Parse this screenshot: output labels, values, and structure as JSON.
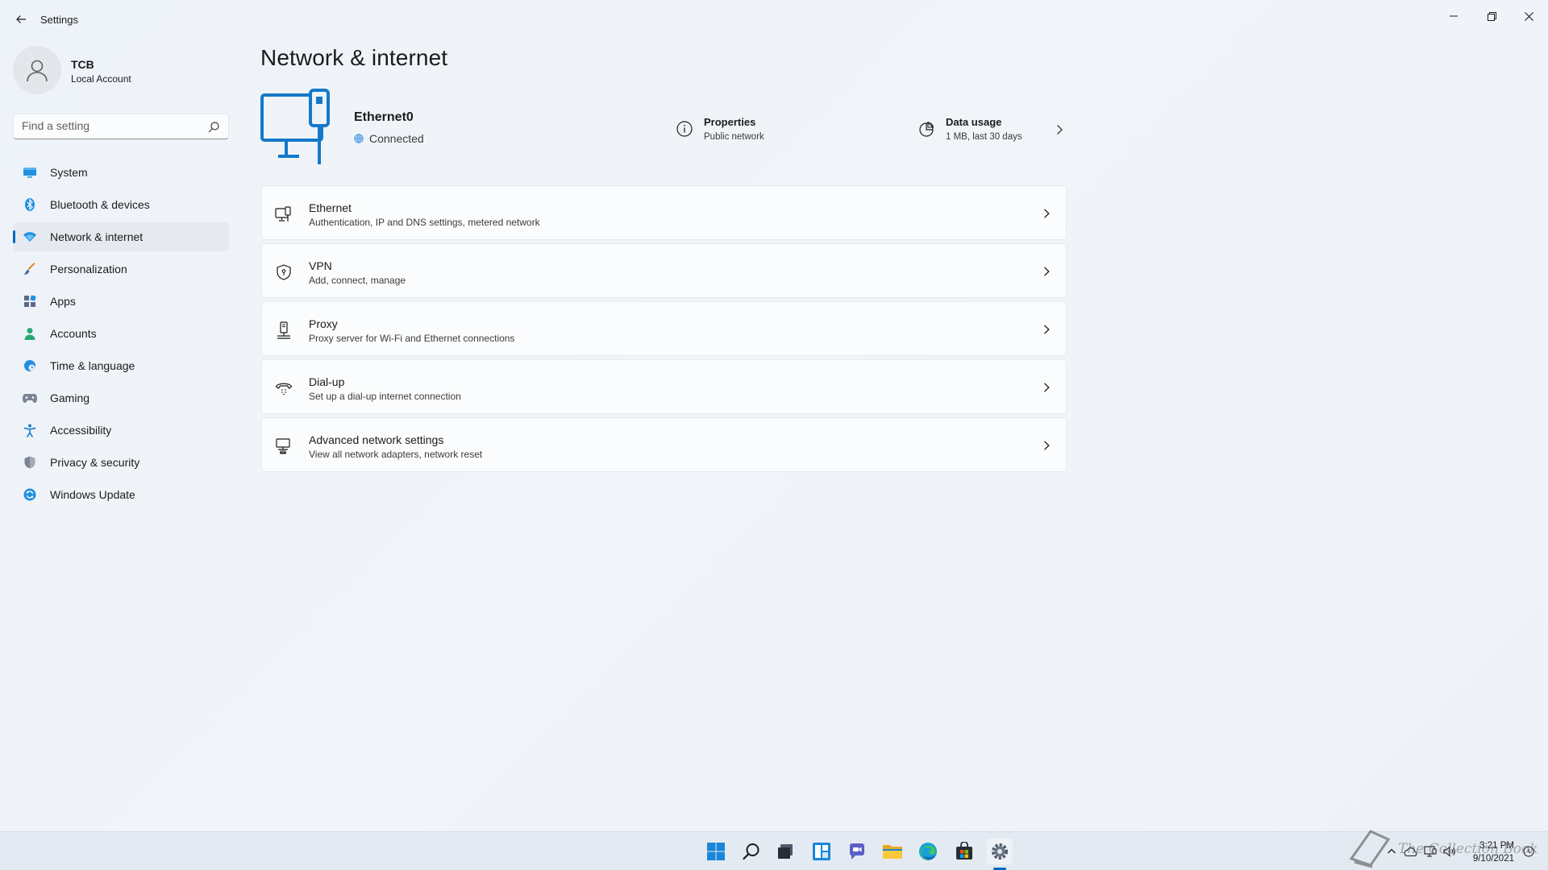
{
  "window": {
    "app_title": "Settings",
    "controls": [
      "minimize",
      "restore",
      "close"
    ]
  },
  "profile": {
    "name": "TCB",
    "account_type": "Local Account"
  },
  "search": {
    "placeholder": "Find a setting"
  },
  "sidebar": {
    "items": [
      {
        "label": "System",
        "icon": "monitor-icon",
        "active": false
      },
      {
        "label": "Bluetooth & devices",
        "icon": "bluetooth-icon",
        "active": false
      },
      {
        "label": "Network & internet",
        "icon": "wifi-icon",
        "active": true
      },
      {
        "label": "Personalization",
        "icon": "brush-icon",
        "active": false
      },
      {
        "label": "Apps",
        "icon": "apps-icon",
        "active": false
      },
      {
        "label": "Accounts",
        "icon": "person-icon",
        "active": false
      },
      {
        "label": "Time & language",
        "icon": "globe-clock-icon",
        "active": false
      },
      {
        "label": "Gaming",
        "icon": "gamepad-icon",
        "active": false
      },
      {
        "label": "Accessibility",
        "icon": "accessibility-icon",
        "active": false
      },
      {
        "label": "Privacy & security",
        "icon": "shield-icon",
        "active": false
      },
      {
        "label": "Windows Update",
        "icon": "update-icon",
        "active": false
      }
    ]
  },
  "main": {
    "title": "Network & internet",
    "connection": {
      "name": "Ethernet0",
      "status": "Connected",
      "properties_title": "Properties",
      "properties_sub": "Public network",
      "usage_title": "Data usage",
      "usage_sub": "1 MB, last 30 days"
    },
    "cards": [
      {
        "title": "Ethernet",
        "sub": "Authentication, IP and DNS settings, metered network",
        "icon": "ethernet-icon"
      },
      {
        "title": "VPN",
        "sub": "Add, connect, manage",
        "icon": "vpn-shield-icon"
      },
      {
        "title": "Proxy",
        "sub": "Proxy server for Wi-Fi and Ethernet connections",
        "icon": "proxy-icon"
      },
      {
        "title": "Dial-up",
        "sub": "Set up a dial-up internet connection",
        "icon": "dialup-icon"
      },
      {
        "title": "Advanced network settings",
        "sub": "View all network adapters, network reset",
        "icon": "advanced-network-icon"
      }
    ]
  },
  "taskbar": {
    "icons": [
      "start-icon",
      "search-icon",
      "task-view-icon",
      "widgets-icon",
      "chat-icon",
      "file-explorer-icon",
      "edge-icon",
      "store-icon",
      "settings-icon"
    ],
    "active": "settings-icon",
    "time": "3:21 PM",
    "date": "9/10/2021"
  },
  "watermark": {
    "text": "The Collection Book"
  },
  "colors": {
    "accent": "#0067c0",
    "background": "#f0f4f9"
  }
}
